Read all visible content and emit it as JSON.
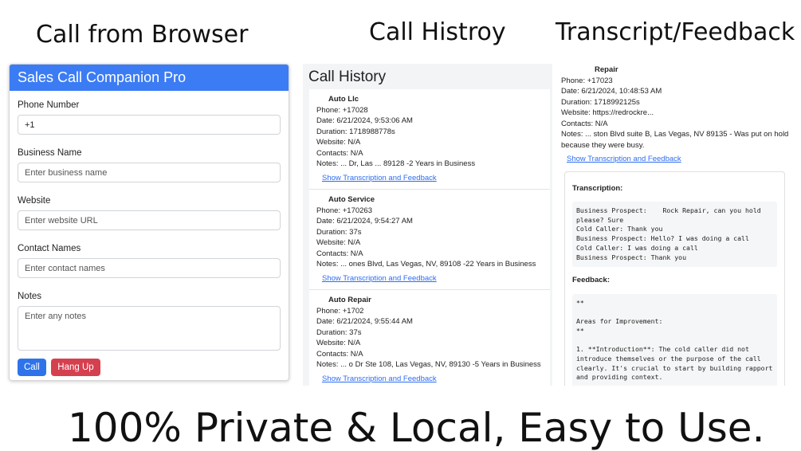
{
  "captions": {
    "left": "Call from Browser",
    "middle": "Call Histroy",
    "right": "Transcript/Feedback",
    "tagline": "100% Private & Local, Easy to Use."
  },
  "form": {
    "title": "Sales Call Companion Pro",
    "phone_label": "Phone Number",
    "phone_value": "+1",
    "business_label": "Business Name",
    "business_placeholder": "Enter business name",
    "website_label": "Website",
    "website_placeholder": "Enter website URL",
    "contacts_label": "Contact Names",
    "contacts_placeholder": "Enter contact names",
    "notes_label": "Notes",
    "notes_placeholder": "Enter any notes",
    "call_label": "Call",
    "hangup_label": "Hang Up"
  },
  "history": {
    "title": "Call History",
    "link": "Show Transcription and Feedback",
    "records": [
      {
        "name": "Auto Llc",
        "phone": "Phone: +17028",
        "date": "Date: 6/21/2024, 9:53:06 AM",
        "duration": "Duration: 1718988778s",
        "website": "Website: N/A",
        "contacts": "Contacts: N/A",
        "notes": "Notes: ... Dr, Las ... 89128 -2 Years in Business"
      },
      {
        "name": "Auto Service",
        "phone": "Phone: +170263",
        "date": "Date: 6/21/2024, 9:54:27 AM",
        "duration": "Duration: 37s",
        "website": "Website: N/A",
        "contacts": "Contacts: N/A",
        "notes": "Notes: ... ones Blvd, Las Vegas, NV, 89108 -22 Years in Business"
      },
      {
        "name": "Auto Repair",
        "phone": "Phone: +1702",
        "date": "Date: 6/21/2024, 9:55:44 AM",
        "duration": "Duration: 37s",
        "website": "Website: N/A",
        "contacts": "Contacts: N/A",
        "notes": "Notes: ... o Dr Ste 108, Las Vegas, NV, 89130 -5 Years in Business"
      }
    ]
  },
  "detail": {
    "name": "Repair",
    "phone": "Phone: +17023",
    "date": "Date: 6/21/2024, 10:48:53 AM",
    "duration": "Duration: 1718992125s",
    "website": "Website: https://redrockre...",
    "contacts": "Contacts: N/A",
    "notes": "Notes: ... ston Blvd suite B, Las Vegas, NV 89135 - Was put on hold because they were busy.",
    "link": "Show Transcription and Feedback",
    "transcription_label": "Transcription:",
    "transcription": "Business Prospect:    Rock Repair, can you hold please? Sure\nCold Caller: Thank you\nBusiness Prospect: Hello? I was doing a call\nCold Caller: I was doing a call\nBusiness Prospect: Thank you",
    "feedback_label": "Feedback:",
    "feedback": "**\n\nAreas for Improvement:\n**\n\n1. **Introduction**: The cold caller did not introduce themselves or the purpose of the call clearly. It's crucial to start by building rapport and providing context."
  }
}
